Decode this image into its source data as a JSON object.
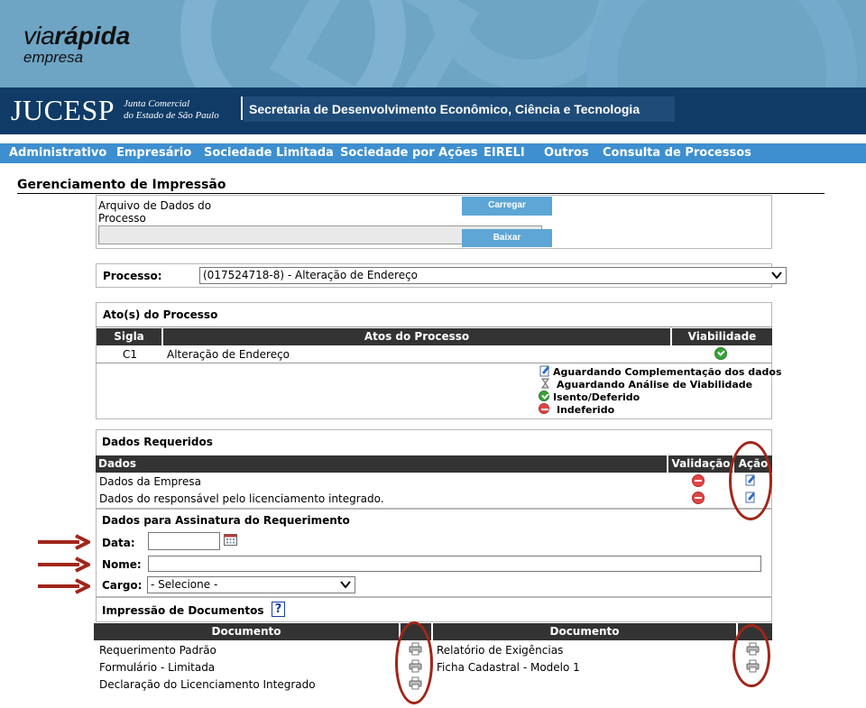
{
  "brand": {
    "via": "via",
    "rapida": "rápida",
    "empresa": "empresa"
  },
  "header": {
    "jucesp": "JUCESP",
    "junta_line1": "Junta Comercial",
    "junta_line2": "do Estado de São Paulo",
    "secretaria": "Secretaria de Desenvolvimento Econômico, Ciência e Tecnologia"
  },
  "nav": [
    "Administrativo",
    "Empresário",
    "Sociedade Limitada",
    "Sociedade por Ações",
    "EIRELI",
    "Outros",
    "Consulta de Processos"
  ],
  "page_title": "Gerenciamento de Impressão",
  "arquivo": {
    "label_line1": "Arquivo de Dados do",
    "label_line2": "Processo",
    "carregar": "Carregar",
    "baixar": "Baixar"
  },
  "processo": {
    "label": "Processo:",
    "selected": "(017524718-8) - Alteração de Endereço"
  },
  "atos": {
    "title": "Ato(s) do Processo",
    "headers": [
      "Sigla",
      "Atos do Processo",
      "Viabilidade"
    ],
    "rows": [
      {
        "sigla": "C1",
        "ato": "Alteração de Endereço",
        "viabilidade": "green-check-icon"
      }
    ],
    "legend": [
      {
        "icon": "edit-icon",
        "text": "Aguardando Complementação dos dados"
      },
      {
        "icon": "hourglass-icon",
        "text": "Aguardando Análise de Viabilidade"
      },
      {
        "icon": "green-check-icon",
        "text": "Isento/Deferido"
      },
      {
        "icon": "red-minus-icon",
        "text": "Indeferido"
      }
    ]
  },
  "dados_requeridos": {
    "title": "Dados Requeridos",
    "headers": [
      "Dados",
      "Validação",
      "Ação"
    ],
    "rows": [
      {
        "dados": "Dados da Empresa",
        "validacao": "red-minus-icon",
        "acao": "edit-icon"
      },
      {
        "dados": "Dados do responsável pelo licenciamento integrado.",
        "validacao": "red-minus-icon",
        "acao": "edit-icon"
      }
    ]
  },
  "assinatura": {
    "title": "Dados para Assinatura do Requerimento",
    "data_label": "Data:",
    "nome_label": "Nome:",
    "cargo_label": "Cargo:",
    "cargo_selected": "- Selecione -"
  },
  "impressao": {
    "title": "Impressão de Documentos",
    "help": "?",
    "headers": [
      "Documento",
      "Documento"
    ],
    "left_docs": [
      "Requerimento Padrão",
      "Formulário - Limitada",
      "Declaração do Licenciamento Integrado"
    ],
    "right_docs": [
      "Relatório de Exigências",
      "Ficha Cadastral - Modelo 1"
    ]
  },
  "colors": {
    "nav_bg": "#3d8fd0",
    "header_bg": "#0f3b66",
    "banner_bg": "#6ea4c4",
    "table_header": "#333333",
    "annotation": "#a0261a"
  }
}
